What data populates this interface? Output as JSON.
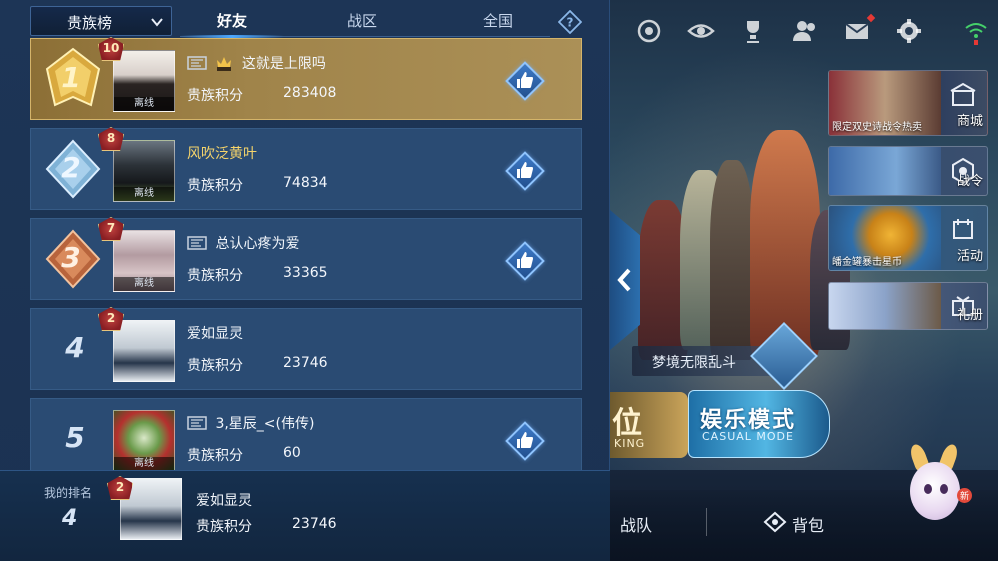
{
  "leaderboard": {
    "dropdown_label": "贵族榜",
    "tabs": [
      {
        "label": "好友",
        "active": true
      },
      {
        "label": "战区",
        "active": false
      },
      {
        "label": "全国",
        "active": false
      }
    ],
    "score_label": "贵族积分",
    "offline_label": "离线",
    "rows": [
      {
        "rank": "1",
        "level": "10",
        "name": "这就是上限吗",
        "score": "283408",
        "offline": true,
        "likeable": true
      },
      {
        "rank": "2",
        "level": "8",
        "name": "风吹泛黄叶",
        "score": "74834",
        "offline": true,
        "likeable": true
      },
      {
        "rank": "3",
        "level": "7",
        "name": "总认心疼为爱",
        "score": "33365",
        "offline": true,
        "likeable": true
      },
      {
        "rank": "4",
        "level": "2",
        "name": "爱如显灵",
        "score": "23746",
        "offline": false,
        "likeable": false
      },
      {
        "rank": "5",
        "level": "",
        "name": "3,星辰_<(伟传)",
        "score": "60",
        "offline": true,
        "likeable": true
      }
    ],
    "my_rank": {
      "label": "我的排名",
      "rank": "4",
      "level": "2",
      "name": "爱如显灵",
      "score": "23746"
    }
  },
  "side_cards": [
    {
      "caption": "限定双史诗战令热卖",
      "label": "商城"
    },
    {
      "caption": "",
      "label": "战令"
    },
    {
      "caption": "皤金罐暴击星币",
      "label": "活动"
    },
    {
      "caption": "",
      "label": "礼册"
    }
  ],
  "modes": {
    "rank_title": "位",
    "rank_sub": "KING",
    "casual_title": "娱乐模式",
    "casual_sub": "CASUAL MODE",
    "dream_label": "梦境无限乱斗"
  },
  "bottom_bar": {
    "team_label": "战队",
    "bag_label": "背包",
    "mascot_badge": "新"
  },
  "colors": {
    "panel_bg": "#1d3556",
    "row_bg": "#2a4b73",
    "first_row_gold": "#a0844a",
    "tab_indicator": "#4ea8ff",
    "level_badge_red": "#8a1f23"
  }
}
